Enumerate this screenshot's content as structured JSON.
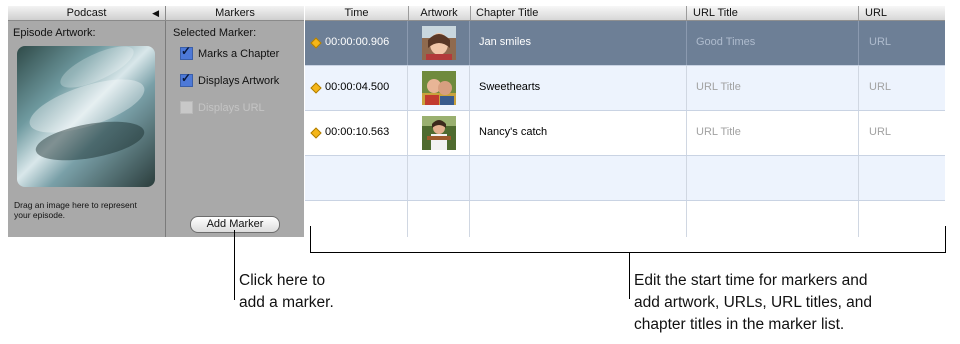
{
  "podcast_panel": {
    "title": "Podcast",
    "episode_artwork_label": "Episode Artwork:",
    "drag_hint": "Drag an image here to represent your episode."
  },
  "markers_panel": {
    "title": "Markers",
    "selected_marker_label": "Selected Marker:",
    "checkboxes": [
      {
        "label": "Marks a Chapter",
        "checked": true,
        "enabled": true
      },
      {
        "label": "Displays Artwork",
        "checked": true,
        "enabled": true
      },
      {
        "label": "Displays URL",
        "checked": false,
        "enabled": false
      }
    ],
    "add_marker_label": "Add Marker"
  },
  "marker_table": {
    "columns": [
      "Time",
      "Artwork",
      "Chapter Title",
      "URL Title",
      "URL"
    ],
    "rows": [
      {
        "time": "00:00:00.906",
        "chapter_title": "Jan smiles",
        "url_title": "Good Times",
        "url": "URL",
        "selected": true,
        "artwork": "portrait-photo"
      },
      {
        "time": "00:00:04.500",
        "chapter_title": "Sweethearts",
        "url_title": "URL Title",
        "url": "URL",
        "selected": false,
        "artwork": "couple-photo"
      },
      {
        "time": "00:00:10.563",
        "chapter_title": "Nancy's catch",
        "url_title": "URL Title",
        "url": "URL",
        "selected": false,
        "artwork": "catch-photo"
      },
      {
        "time": "",
        "chapter_title": "",
        "url_title": "",
        "url": "",
        "selected": false,
        "artwork": ""
      },
      {
        "time": "",
        "chapter_title": "",
        "url_title": "",
        "url": "",
        "selected": false,
        "artwork": ""
      }
    ]
  },
  "callouts": {
    "add_marker": "Click here to\nadd a marker.",
    "marker_list": "Edit the start time for markers and\nadd artwork, URLs, URL titles, and\nchapter titles in the marker list."
  },
  "colors": {
    "panel_bg": "#a9a9a9",
    "selected_row": "#6d7f96",
    "alt_row": "#edf3fd",
    "marker_diamond": "#f5b619"
  }
}
